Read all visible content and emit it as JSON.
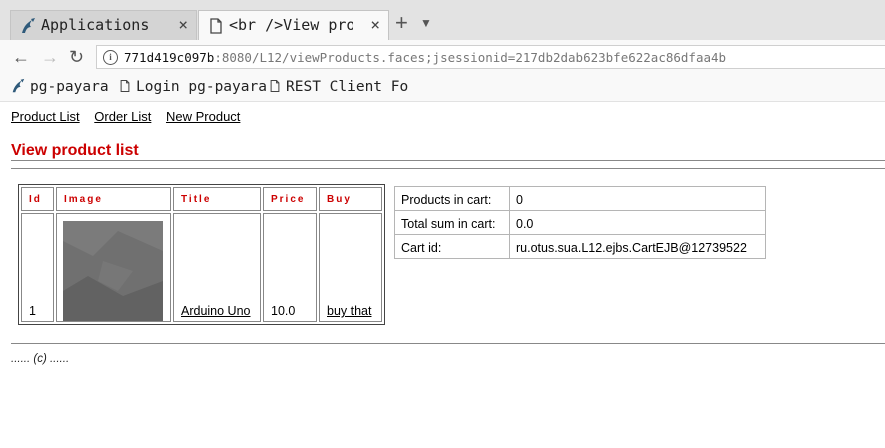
{
  "browser": {
    "tabs": [
      {
        "title": "Applications",
        "close": "×",
        "active": false
      },
      {
        "title": "<br />View products",
        "close": "×",
        "active": true
      }
    ],
    "new_tab": "+",
    "tab_list": "▼",
    "nav": {
      "back": "←",
      "forward": "→",
      "reload": "↻"
    },
    "url": {
      "host": "771d419c097b",
      "rest": ":8080/L12/viewProducts.faces;jsessionid=217db2dab623bfe622ac86dfaa4b"
    },
    "bookmarks": [
      {
        "label": "pg-payara",
        "icon": "payara-logo-icon"
      },
      {
        "label": "Login pg-payara",
        "icon": "page-icon"
      },
      {
        "label": "REST Client For",
        "icon": "page-icon"
      }
    ]
  },
  "page": {
    "links": [
      "Product List",
      "Order List",
      "New Product"
    ],
    "heading": "View product list",
    "products": {
      "headers": [
        "Id",
        "Image",
        "Title",
        "Price",
        "Buy"
      ],
      "rows": [
        {
          "id": "1",
          "title": "Arduino Uno",
          "price": "10.0",
          "buy": "buy that"
        }
      ]
    },
    "cart": [
      {
        "label": "Products in cart:",
        "value": "0"
      },
      {
        "label": "Total sum in cart:",
        "value": "0.0"
      },
      {
        "label": "Cart id:",
        "value": "ru.otus.sua.L12.ejbs.CartEJB@12739522"
      }
    ],
    "footer": "...... (c) ......"
  }
}
